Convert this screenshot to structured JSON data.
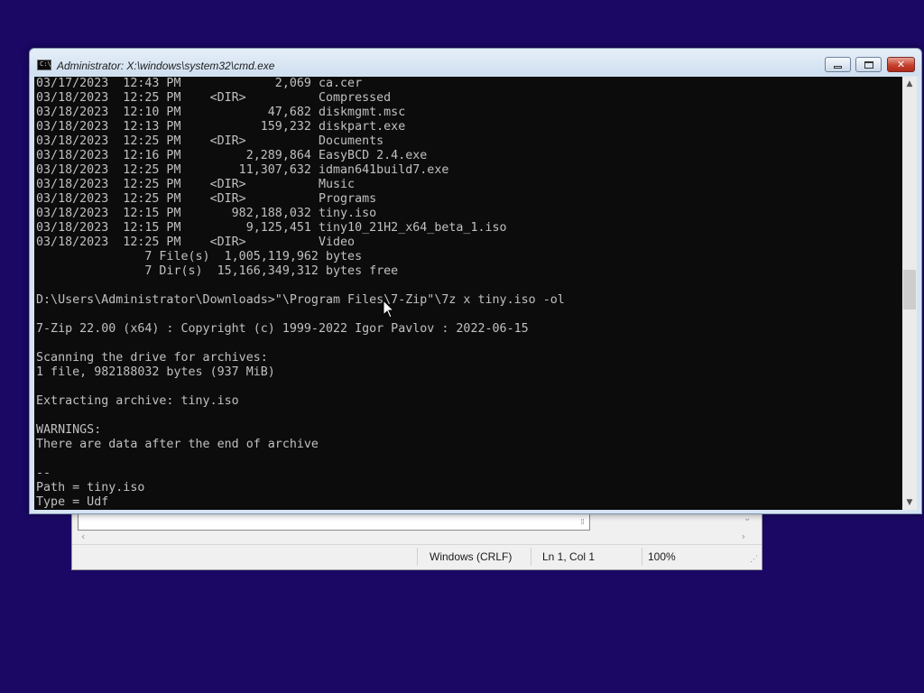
{
  "notepad": {
    "encoding": "Windows (CRLF)",
    "position": "Ln 1, Col 1",
    "zoom": "100%"
  },
  "cmd": {
    "title": "Administrator: X:\\windows\\system32\\cmd.exe",
    "icon_text": "C:\\",
    "lines": [
      "03/17/2023  12:43 PM             2,069 ca.cer",
      "03/18/2023  12:25 PM    <DIR>          Compressed",
      "03/18/2023  12:10 PM            47,682 diskmgmt.msc",
      "03/18/2023  12:13 PM           159,232 diskpart.exe",
      "03/18/2023  12:25 PM    <DIR>          Documents",
      "03/18/2023  12:16 PM         2,289,864 EasyBCD 2.4.exe",
      "03/18/2023  12:25 PM        11,307,632 idman641build7.exe",
      "03/18/2023  12:25 PM    <DIR>          Music",
      "03/18/2023  12:25 PM    <DIR>          Programs",
      "03/18/2023  12:15 PM       982,188,032 tiny.iso",
      "03/18/2023  12:15 PM         9,125,451 tiny10_21H2_x64_beta_1.iso",
      "03/18/2023  12:25 PM    <DIR>          Video",
      "               7 File(s)  1,005,119,962 bytes",
      "               7 Dir(s)  15,166,349,312 bytes free",
      "",
      "D:\\Users\\Administrator\\Downloads>\"\\Program Files\\7-Zip\"\\7z x tiny.iso -ol",
      "",
      "7-Zip 22.00 (x64) : Copyright (c) 1999-2022 Igor Pavlov : 2022-06-15",
      "",
      "Scanning the drive for archives:",
      "1 file, 982188032 bytes (937 MiB)",
      "",
      "Extracting archive: tiny.iso",
      "",
      "WARNINGS:",
      "There are data after the end of archive",
      "",
      "--",
      "Path = tiny.iso",
      "Type = Udf"
    ]
  }
}
